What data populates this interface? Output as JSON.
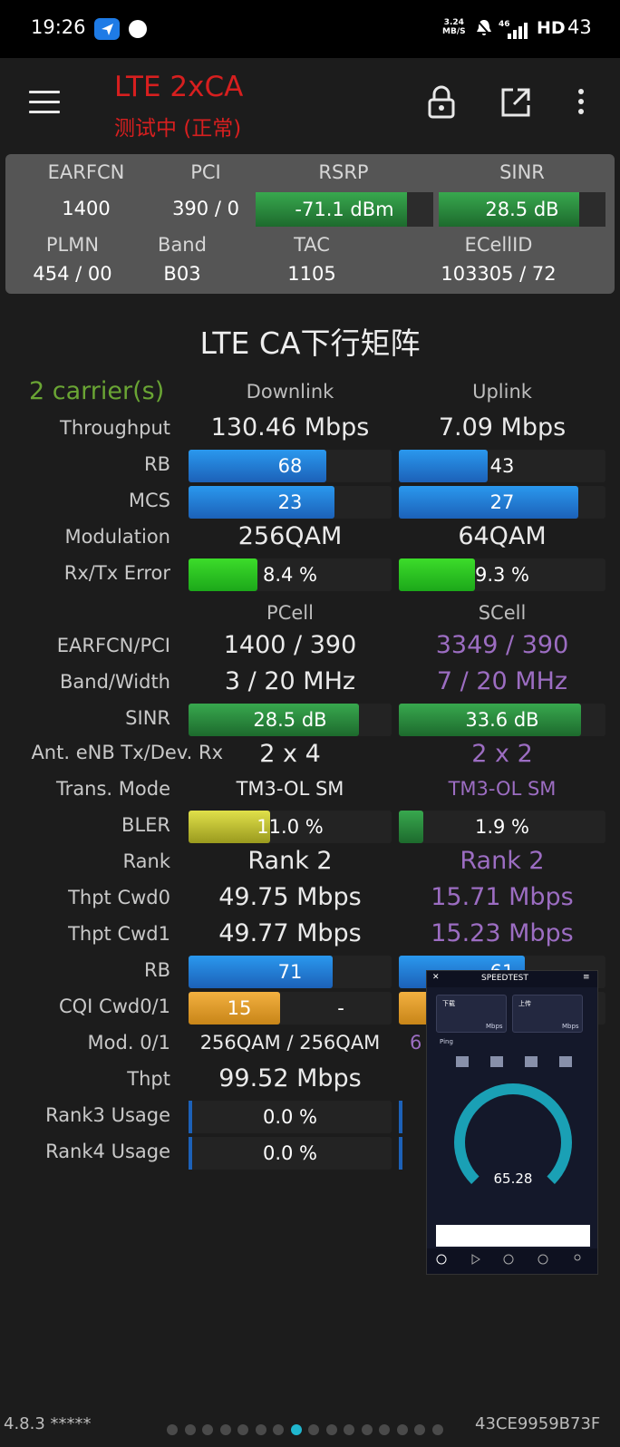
{
  "status": {
    "time": "19:26",
    "speed_top": "3.24",
    "speed_bottom": "MB/S",
    "signal_tag": "46",
    "hd": "HD",
    "battery": "43"
  },
  "app": {
    "title": "LTE 2xCA",
    "subtitle": "测试中 (正常)"
  },
  "info": {
    "h_earfcn": "EARFCN",
    "h_pci": "PCI",
    "h_rsrp": "RSRP",
    "h_sinr": "SINR",
    "earfcn": "1400",
    "pci": "390 / 0",
    "rsrp": "-71.1 dBm",
    "sinr": "28.5 dB",
    "rsrp_level": 0.85,
    "sinr_level": 0.84,
    "h_plmn": "PLMN",
    "h_band": "Band",
    "h_tac": "TAC",
    "h_ecellid": "ECellID",
    "plmn": "454 / 00",
    "band": "B03",
    "tac": "1105",
    "ecellid": "103305 / 72"
  },
  "matrix": {
    "title": "LTE CA下行矩阵",
    "carriers": "2 carrier(s)",
    "h_dl": "Downlink",
    "h_ul": "Uplink",
    "rows1": {
      "throughput": {
        "label": "Throughput",
        "dl": "130.46 Mbps",
        "ul": "7.09 Mbps"
      },
      "rb": {
        "label": "RB",
        "dl": "68",
        "ul": "43",
        "dl_level": 0.68,
        "ul_level": 0.43
      },
      "mcs": {
        "label": "MCS",
        "dl": "23",
        "ul": "27",
        "dl_level": 0.72,
        "ul_level": 0.87
      },
      "modulation": {
        "label": "Modulation",
        "dl": "256QAM",
        "ul": "64QAM"
      },
      "error": {
        "label": "Rx/Tx Error",
        "dl": "8.4 %",
        "ul": "9.3 %",
        "dl_level": 0.34,
        "ul_level": 0.37
      }
    },
    "h_pcell": "PCell",
    "h_scell": "SCell",
    "rows2": {
      "earfcn_pci": {
        "label": "EARFCN/PCI",
        "p": "1400 / 390",
        "s": "3349 / 390"
      },
      "band_width": {
        "label": "Band/Width",
        "p": "3 / 20 MHz",
        "s": "7 / 20 MHz"
      },
      "sinr": {
        "label": "SINR",
        "p": "28.5 dB",
        "s": "33.6 dB",
        "p_level": 0.84,
        "s_level": 0.88
      },
      "ant": {
        "label": "Ant. eNB Tx/Dev. Rx",
        "p": "2 x 4",
        "s": "2 x 2"
      },
      "tmode": {
        "label": "Trans. Mode",
        "p": "TM3-OL SM",
        "s": "TM3-OL SM"
      },
      "bler": {
        "label": "BLER",
        "p": "11.0 %",
        "s": "1.9 %",
        "p_level": 0.4,
        "s_level": 0.12
      },
      "rank": {
        "label": "Rank",
        "p": "Rank 2",
        "s": "Rank 2"
      },
      "cwd0": {
        "label": "Thpt Cwd0",
        "p": "49.75 Mbps",
        "s": "15.71 Mbps"
      },
      "cwd1": {
        "label": "Thpt Cwd1",
        "p": "49.77 Mbps",
        "s": "15.23 Mbps"
      },
      "rb": {
        "label": "RB",
        "p": "71",
        "s": "61",
        "p_level": 0.71,
        "s_level": 0.61
      },
      "cqi": {
        "label": "CQI Cwd0/1",
        "p": "15",
        "p2": "-",
        "p_level": 0.45,
        "s_level": 0.4
      },
      "mod": {
        "label": "Mod. 0/1",
        "p": "256QAM / 256QAM",
        "s": "6"
      },
      "thpt": {
        "label": "Thpt",
        "p": "99.52 Mbps"
      },
      "rank3": {
        "label": "Rank3 Usage",
        "p": "0.0 %"
      },
      "rank4": {
        "label": "Rank4 Usage",
        "p": "0.0 %"
      }
    }
  },
  "overlay": {
    "title": "SPEEDTEST",
    "dl_label": "下载",
    "ul_label": "上传",
    "unit": "Mbps",
    "speed": "65.28",
    "ping": "Ping"
  },
  "footer": {
    "version": "4.8.3 *****",
    "device_id": "43CE9959B73F",
    "page_count": 16,
    "active_page": 7
  }
}
